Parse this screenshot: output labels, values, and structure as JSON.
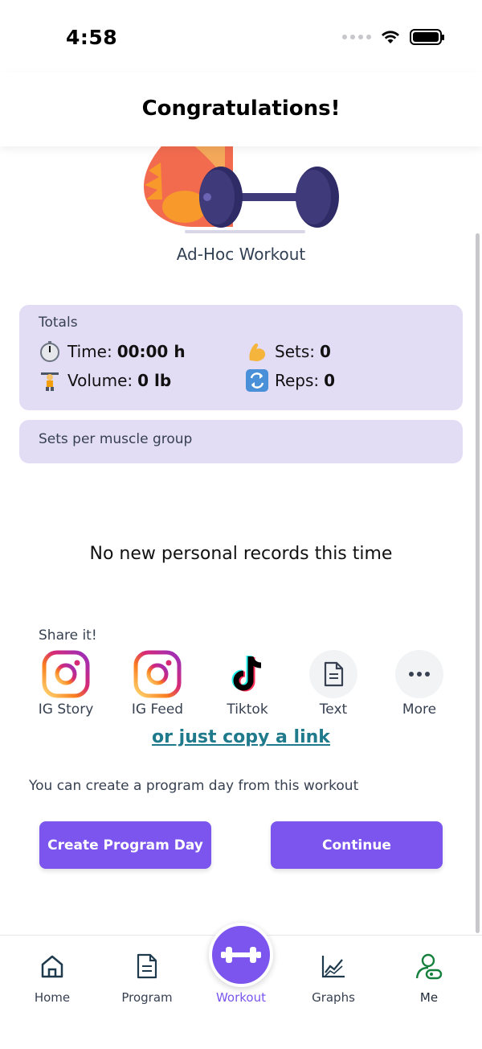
{
  "status_bar": {
    "time": "4:58"
  },
  "header": {
    "title": "Congratulations!"
  },
  "workout": {
    "name": "Ad-Hoc Workout"
  },
  "totals": {
    "label": "Totals",
    "time_label": "Time:",
    "time_value": "00:00 h",
    "volume_label": "Volume:",
    "volume_value": "0 lb",
    "sets_label": "Sets:",
    "sets_value": "0",
    "reps_label": "Reps:",
    "reps_value": "0"
  },
  "muscle_groups": {
    "label": "Sets per muscle group"
  },
  "records": {
    "message": "No new personal records this time"
  },
  "share": {
    "label": "Share it!",
    "items": [
      {
        "label": "IG Story",
        "icon": "instagram-icon"
      },
      {
        "label": "IG Feed",
        "icon": "instagram-icon"
      },
      {
        "label": "Tiktok",
        "icon": "tiktok-icon"
      },
      {
        "label": "Text",
        "icon": "document-icon"
      },
      {
        "label": "More",
        "icon": "more-icon"
      }
    ],
    "copy_link": "or just copy a link"
  },
  "program": {
    "hint": "You can create a program day from this workout",
    "create_label": "Create Program Day",
    "continue_label": "Continue"
  },
  "nav": {
    "items": [
      {
        "label": "Home",
        "icon": "home-icon"
      },
      {
        "label": "Program",
        "icon": "program-icon"
      },
      {
        "label": "Workout",
        "icon": "dumbbell-icon"
      },
      {
        "label": "Graphs",
        "icon": "graphs-icon"
      },
      {
        "label": "Me",
        "icon": "profile-icon"
      }
    ]
  },
  "colors": {
    "accent": "#7b55ee",
    "card_bg": "#e2dcf5",
    "link": "#1f7a8c"
  }
}
